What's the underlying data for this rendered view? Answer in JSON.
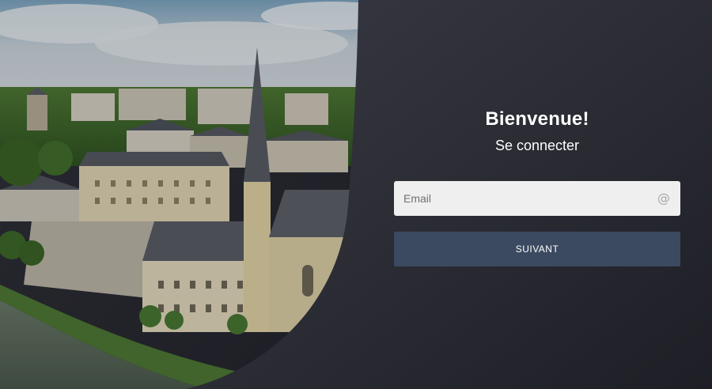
{
  "login": {
    "title": "Bienvenue!",
    "subtitle": "Se connecter",
    "email_placeholder": "Email",
    "email_value": "",
    "email_icon": "at-icon",
    "next_label": "SUIVANT"
  },
  "colors": {
    "panel_bg": "#2a2b33",
    "button_bg": "#3b4a60",
    "input_bg": "#efefef",
    "text_primary": "#ffffff"
  }
}
